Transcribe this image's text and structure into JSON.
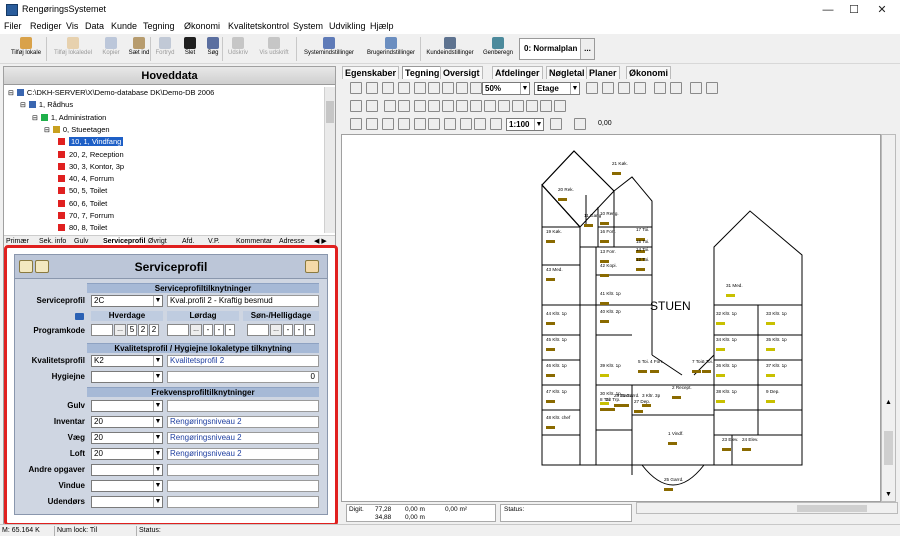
{
  "window": {
    "title": "RengøringsSystemet",
    "min": "—",
    "max": "☐",
    "close": "✕"
  },
  "menu": [
    "Filer",
    "Rediger",
    "Vis",
    "Data",
    "Kunde",
    "Tegning",
    "Økonomi",
    "Kvalitetskontrol",
    "System",
    "Udvikling",
    "Hjælp"
  ],
  "toolbar": {
    "buttons": [
      {
        "label": "Tilføj lokale",
        "enabled": true,
        "color": "#d9a24a"
      },
      {
        "label": "Tilføj lokaledel",
        "enabled": false,
        "color": "#d9a24a"
      },
      {
        "label": "Kopier",
        "enabled": false,
        "color": "#6d8ab9"
      },
      {
        "label": "Sæt ind",
        "enabled": true,
        "color": "#b79c6e"
      },
      {
        "label": "Fortryd",
        "enabled": false,
        "color": "#7a8fb0"
      },
      {
        "label": "Slet",
        "enabled": true,
        "color": "#202020"
      },
      {
        "label": "Søg",
        "enabled": true,
        "color": "#5b6fa0"
      },
      {
        "label": "Udskriv",
        "enabled": false,
        "color": "#888888"
      },
      {
        "label": "Vis udskrift",
        "enabled": false,
        "color": "#888888"
      },
      {
        "label": "Systemindstillinger",
        "enabled": true,
        "color": "#5f7bb8"
      },
      {
        "label": "Brugerindstillinger",
        "enabled": true,
        "color": "#6b8ec0"
      },
      {
        "label": "Kundeindstillinger",
        "enabled": true,
        "color": "#5e7390"
      },
      {
        "label": "Genberegn",
        "enabled": true,
        "color": "#4c8a9c"
      }
    ],
    "plan": "0: Normalplan",
    "plan_more": "..."
  },
  "left": {
    "header": "Hoveddata",
    "tree": [
      {
        "label": "C:\\DKH-SERVER\\X\\Demo-database DK\\Demo-DB 2006",
        "level": 0,
        "color": "#3a66b0"
      },
      {
        "label": "1, Rådhus",
        "level": 1,
        "color": "#3a66b0"
      },
      {
        "label": "1, Administration",
        "level": 2,
        "color": "#1fb04a"
      },
      {
        "label": "0, Stueetagen",
        "level": 3,
        "color": "#c8a020"
      },
      {
        "label": "10, 1, Vindfang",
        "level": 4,
        "color": "#e02020",
        "selected": true
      },
      {
        "label": "20, 2, Reception",
        "level": 4,
        "color": "#e02020"
      },
      {
        "label": "30, 3, Kontor, 3p",
        "level": 4,
        "color": "#e02020"
      },
      {
        "label": "40, 4, Forrum",
        "level": 4,
        "color": "#e02020"
      },
      {
        "label": "50, 5, Toilet",
        "level": 4,
        "color": "#e02020"
      },
      {
        "label": "60, 6, Toilet",
        "level": 4,
        "color": "#e02020"
      },
      {
        "label": "70, 7, Forrum",
        "level": 4,
        "color": "#e02020"
      },
      {
        "label": "80, 8, Toilet",
        "level": 4,
        "color": "#e02020"
      }
    ],
    "tabs": [
      "Primær",
      "Sek. info",
      "Gulv",
      "Serviceprofil",
      "Øvrigt",
      "Afd.",
      "V.P.",
      "Kommentar",
      "Adresse"
    ],
    "tab_arrows": "◀ ▶"
  },
  "serviceprofil": {
    "title": "Serviceprofil",
    "sec1": "Serviceprofiltilknytninger",
    "serviceprofil_label": "Serviceprofil",
    "serviceprofil_value": "2C",
    "serviceprofil_desc": "Kval.profil 2 - Kraftig besmud",
    "hverdage": "Hverdage",
    "lordag": "Lørdag",
    "sondag": "Søn-/Helligdage",
    "programkode_label": "Programkode",
    "hverdage_days": [
      "5",
      "2",
      "2"
    ],
    "lordag_days": [
      "-",
      "-",
      "-"
    ],
    "sondag_days": [
      "-",
      "-",
      "-"
    ],
    "sec2": "Kvalitetsprofil / Hygiejne lokaletype tilknytning",
    "kvalitet_label": "Kvalitetsprofil",
    "kvalitet_value": "K2",
    "kvalitet_desc": "Kvalitetsprofil 2",
    "hygiejne_label": "Hygiejne",
    "hygiejne_value": "",
    "hygiejne_count": "0",
    "sec3": "Frekvensprofiltilknytninger",
    "frekvens": [
      {
        "label": "Gulv",
        "value": "",
        "desc": ""
      },
      {
        "label": "Inventar",
        "value": "20",
        "desc": "Rengøringsniveau 2"
      },
      {
        "label": "Væg",
        "value": "20",
        "desc": "Rengøringsniveau 2"
      },
      {
        "label": "Loft",
        "value": "20",
        "desc": "Rengøringsniveau 2"
      },
      {
        "label": "Andre opgaver",
        "value": "",
        "desc": ""
      },
      {
        "label": "Vindue",
        "value": "",
        "desc": ""
      },
      {
        "label": "Udendørs",
        "value": "",
        "desc": ""
      }
    ]
  },
  "right": {
    "tabs": [
      "Egenskaber",
      "Tegning",
      "Oversigt",
      "Afdelinger",
      "Nøgletal",
      "Planer",
      "Økonomi"
    ],
    "active_tab": "Tegning",
    "zoom": "50%",
    "level": "Etage",
    "scale": "1:100",
    "line_width": "0,00",
    "floor_label": "STUEN",
    "rooms": [
      "21 Køk.",
      "20 Rek.",
      "11 Gang",
      "10 Reng.",
      "17 Toi.",
      "16 Forr.",
      "15 Toi.",
      "14 Toi.",
      "13 Forr.",
      "12 Toi.",
      "19 Køk.",
      "43 Med.",
      "42 Kopi.",
      "41 Kltr. 1p",
      "40 Kltr. 2p",
      "44 Kltr. 1p",
      "45 Kltr. 1p",
      "46 Kltr. 1p",
      "47 Kltr. 1p",
      "48 Kltr. chef",
      "39 Kltr. 1p",
      "30 Kltr. 1p",
      "31 Med.",
      "32 Kltr. 1p",
      "33 Kltr. 1p",
      "34 Kltr. 1p",
      "35 Kltr. 1p",
      "36 Kltr. 1p",
      "37 Kltr. 1p",
      "38 Kltr. 1p",
      "9 Dep.",
      "8 Toi.",
      "7 Toi.",
      "6 Toi.",
      "5 Toi.",
      "4 Forr.",
      "3 Kltr. 3p",
      "2 Recept.",
      "1 Vindf.",
      "25 Garrd.",
      "26 Garrd.",
      "27 Dep.",
      "28 Garrd.",
      "22 Trp.",
      "23 Elev.",
      "24 Elev."
    ]
  },
  "digit": {
    "label": "Digit.",
    "x": "77,28",
    "y": "34,88",
    "dx": "0,00 m",
    "dy": "0,00 m",
    "area": "0,00 m²"
  },
  "status2": "Status:",
  "statusbar": [
    "M: 65.164 K",
    "Num lock: Til",
    "Status:"
  ]
}
